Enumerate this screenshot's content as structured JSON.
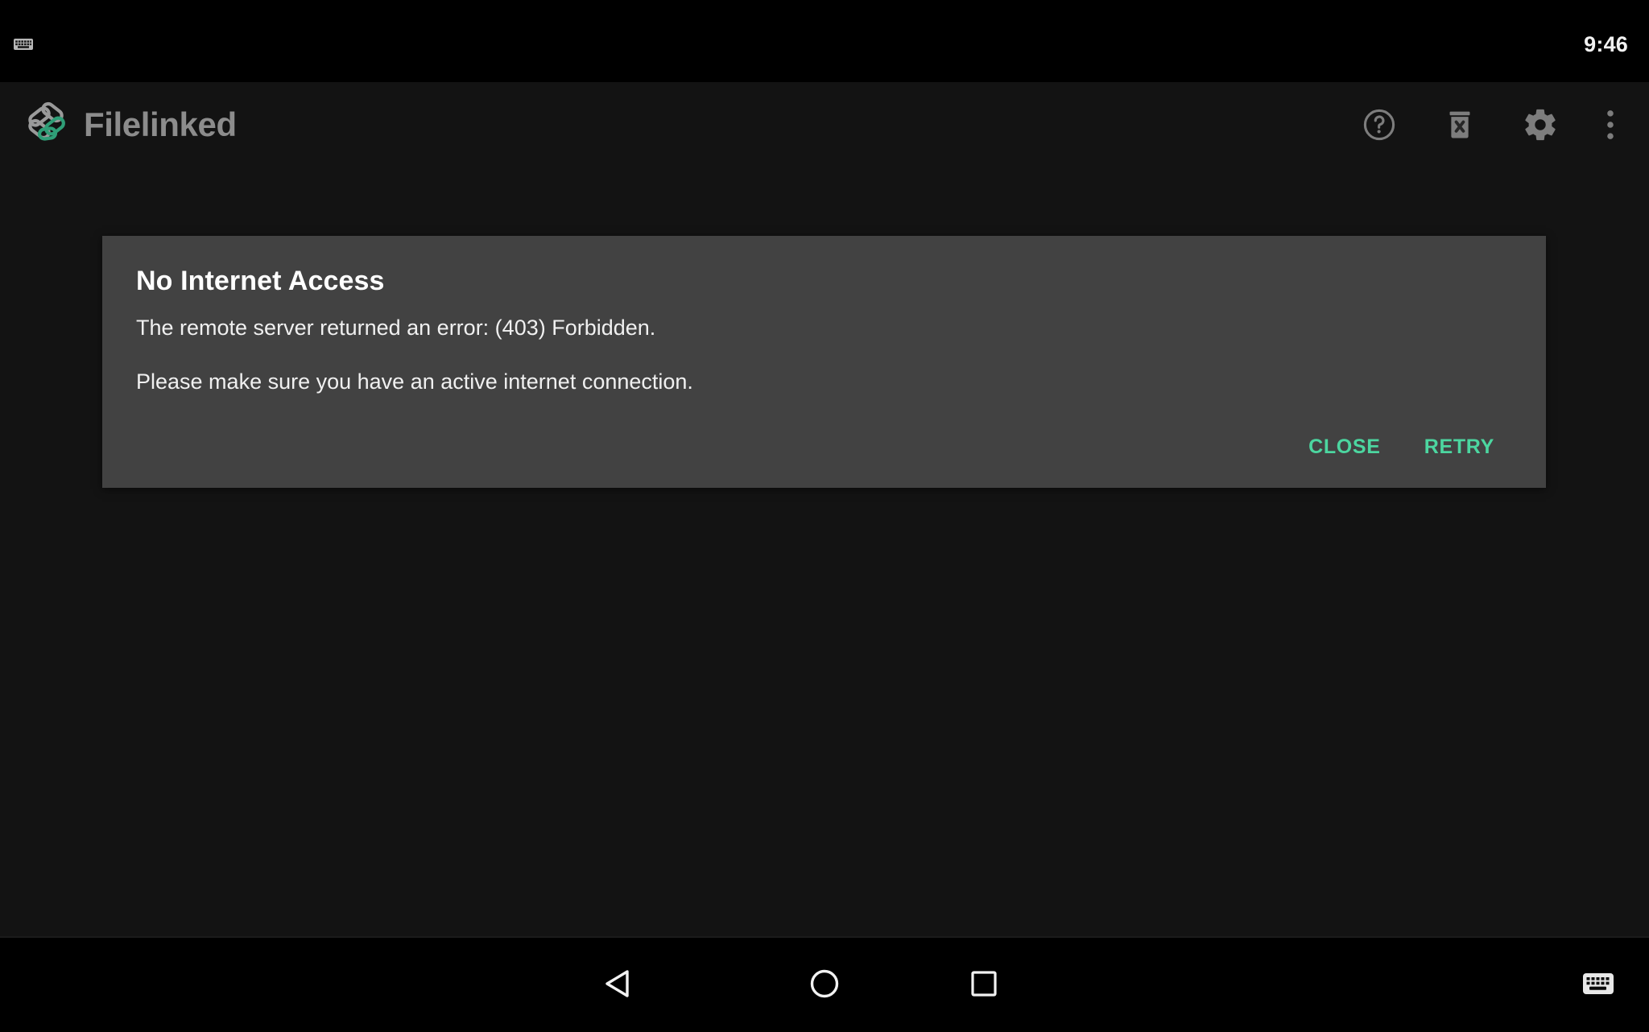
{
  "status_bar": {
    "keyboard_icon": "keyboard-icon",
    "clock": "9:46"
  },
  "app_bar": {
    "brand_name": "Filelinked",
    "logo_icon": "filelinked-logo-icon",
    "actions": [
      {
        "name": "help",
        "icon": "help-circle-icon"
      },
      {
        "name": "clear",
        "icon": "trash-delete-icon"
      },
      {
        "name": "settings",
        "icon": "gear-icon"
      },
      {
        "name": "more",
        "icon": "overflow-menu-icon"
      }
    ]
  },
  "dialog": {
    "title": "No Internet Access",
    "message_line_1": "The remote server returned an error: (403) Forbidden.",
    "message_line_2": "Please make sure you have an active internet connection.",
    "close_label": "CLOSE",
    "retry_label": "RETRY"
  },
  "nav_bar": {
    "back_icon": "back-triangle-icon",
    "home_icon": "home-circle-icon",
    "recents_icon": "recents-square-icon",
    "ime_icon": "keyboard-switcher-icon"
  },
  "colors": {
    "background": "#131313",
    "status_bar": "#000000",
    "dialog_surface": "#424242",
    "accent_green": "#4cd6a0",
    "brand_text": "#8c8c8c",
    "icon_gray": "#7d7d7d"
  }
}
